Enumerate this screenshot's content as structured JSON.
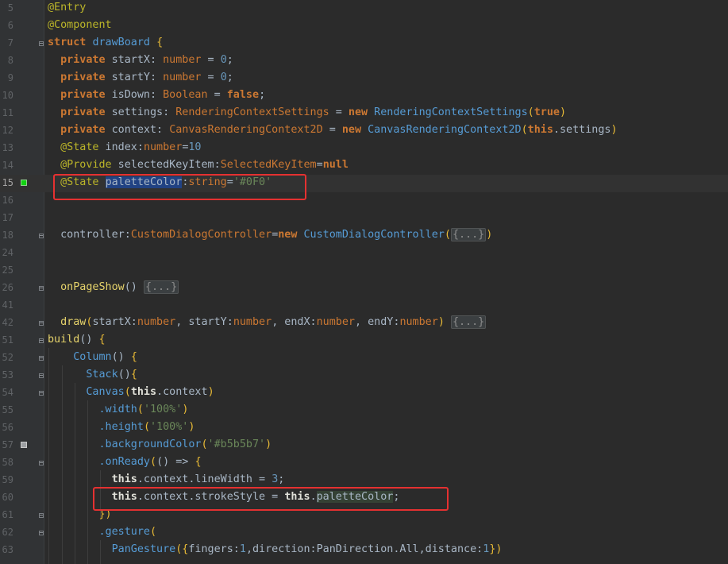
{
  "editor": {
    "lines": [
      {
        "num": "5",
        "tokens": [
          {
            "t": "@Entry",
            "c": "ann"
          }
        ]
      },
      {
        "num": "6",
        "tokens": [
          {
            "t": "@Component",
            "c": "ann"
          }
        ]
      },
      {
        "num": "7",
        "fold": true,
        "tokens": [
          {
            "t": "struct",
            "c": "kw"
          },
          {
            "t": " ",
            "c": "pu"
          },
          {
            "t": "drawBoard",
            "c": "cls"
          },
          {
            "t": " ",
            "c": "pu"
          },
          {
            "t": "{",
            "c": "br"
          }
        ]
      },
      {
        "num": "8",
        "tokens": [
          {
            "t": "  private",
            "c": "kw"
          },
          {
            "t": " startX: ",
            "c": "id"
          },
          {
            "t": "number",
            "c": "ty"
          },
          {
            "t": " = ",
            "c": "pu"
          },
          {
            "t": "0",
            "c": "num"
          },
          {
            "t": ";",
            "c": "pu"
          }
        ]
      },
      {
        "num": "9",
        "tokens": [
          {
            "t": "  private",
            "c": "kw"
          },
          {
            "t": " startY: ",
            "c": "id"
          },
          {
            "t": "number",
            "c": "ty"
          },
          {
            "t": " = ",
            "c": "pu"
          },
          {
            "t": "0",
            "c": "num"
          },
          {
            "t": ";",
            "c": "pu"
          }
        ]
      },
      {
        "num": "10",
        "tokens": [
          {
            "t": "  private",
            "c": "kw"
          },
          {
            "t": " isDown: ",
            "c": "id"
          },
          {
            "t": "Boolean",
            "c": "ty"
          },
          {
            "t": " = ",
            "c": "pu"
          },
          {
            "t": "false",
            "c": "kw"
          },
          {
            "t": ";",
            "c": "pu"
          }
        ]
      },
      {
        "num": "11",
        "tokens": [
          {
            "t": "  private",
            "c": "kw"
          },
          {
            "t": " settings: ",
            "c": "id"
          },
          {
            "t": "RenderingContextSettings",
            "c": "ty"
          },
          {
            "t": " = ",
            "c": "pu"
          },
          {
            "t": "new",
            "c": "kw"
          },
          {
            "t": " ",
            "c": "pu"
          },
          {
            "t": "RenderingContextSettings",
            "c": "cls"
          },
          {
            "t": "(",
            "c": "br"
          },
          {
            "t": "true",
            "c": "kw"
          },
          {
            "t": ")",
            "c": "br"
          }
        ]
      },
      {
        "num": "12",
        "tokens": [
          {
            "t": "  private",
            "c": "kw"
          },
          {
            "t": " context: ",
            "c": "id"
          },
          {
            "t": "CanvasRenderingContext2D",
            "c": "ty"
          },
          {
            "t": " = ",
            "c": "pu"
          },
          {
            "t": "new",
            "c": "kw"
          },
          {
            "t": " ",
            "c": "pu"
          },
          {
            "t": "CanvasRenderingContext2D",
            "c": "cls"
          },
          {
            "t": "(",
            "c": "br"
          },
          {
            "t": "this",
            "c": "kw"
          },
          {
            "t": ".settings",
            "c": "id"
          },
          {
            "t": ")",
            "c": "br"
          }
        ]
      },
      {
        "num": "13",
        "tokens": [
          {
            "t": "  @State",
            "c": "ann"
          },
          {
            "t": " index:",
            "c": "id"
          },
          {
            "t": "number",
            "c": "ty"
          },
          {
            "t": "=",
            "c": "pu"
          },
          {
            "t": "10",
            "c": "num"
          }
        ]
      },
      {
        "num": "14",
        "tokens": [
          {
            "t": "  @Provide",
            "c": "ann"
          },
          {
            "t": " selectedKeyItem:",
            "c": "id"
          },
          {
            "t": "SelectedKeyItem",
            "c": "ty"
          },
          {
            "t": "=",
            "c": "pu"
          },
          {
            "t": "null",
            "c": "kw"
          }
        ]
      },
      {
        "num": "15",
        "current": true,
        "marker": "green",
        "tokens": [
          {
            "t": "  ",
            "c": "pu"
          },
          {
            "t": "@State",
            "c": "ann"
          },
          {
            "t": " ",
            "c": "pu"
          },
          {
            "t": "paletteColor",
            "c": "sel"
          },
          {
            "t": ":",
            "c": "pu"
          },
          {
            "t": "string",
            "c": "ty"
          },
          {
            "t": "=",
            "c": "pu"
          },
          {
            "t": "'#0F0'",
            "c": "str"
          }
        ]
      },
      {
        "num": "16",
        "tokens": []
      },
      {
        "num": "17",
        "tokens": []
      },
      {
        "num": "18",
        "fold": true,
        "tokens": [
          {
            "t": "  controller:",
            "c": "id"
          },
          {
            "t": "CustomDialogController",
            "c": "ty"
          },
          {
            "t": "=",
            "c": "pu"
          },
          {
            "t": "new",
            "c": "kw"
          },
          {
            "t": " ",
            "c": "pu"
          },
          {
            "t": "CustomDialogController",
            "c": "cls"
          },
          {
            "t": "(",
            "c": "br"
          },
          {
            "t": "{...}",
            "c": "fd"
          },
          {
            "t": ")",
            "c": "br"
          }
        ]
      },
      {
        "num": "24",
        "tokens": []
      },
      {
        "num": "25",
        "tokens": []
      },
      {
        "num": "26",
        "fold": true,
        "tokens": [
          {
            "t": "  onPageShow",
            "c": "ye"
          },
          {
            "t": "() ",
            "c": "pu"
          },
          {
            "t": "{...}",
            "c": "fd"
          }
        ]
      },
      {
        "num": "41",
        "tokens": []
      },
      {
        "num": "42",
        "fold": true,
        "tokens": [
          {
            "t": "  draw",
            "c": "ye"
          },
          {
            "t": "(",
            "c": "br"
          },
          {
            "t": "startX:",
            "c": "id"
          },
          {
            "t": "number",
            "c": "ty"
          },
          {
            "t": ", startY:",
            "c": "id"
          },
          {
            "t": "number",
            "c": "ty"
          },
          {
            "t": ", endX:",
            "c": "id"
          },
          {
            "t": "number",
            "c": "ty"
          },
          {
            "t": ", endY:",
            "c": "id"
          },
          {
            "t": "number",
            "c": "ty"
          },
          {
            "t": ")",
            "c": "br"
          },
          {
            "t": " ",
            "c": "pu"
          },
          {
            "t": "{...}",
            "c": "fd"
          }
        ]
      },
      {
        "num": "51",
        "fold": true,
        "tokens": [
          {
            "t": "build",
            "c": "ye"
          },
          {
            "t": "() ",
            "c": "pu"
          },
          {
            "t": "{",
            "c": "br"
          }
        ]
      },
      {
        "num": "52",
        "fold": true,
        "tokens": [
          {
            "t": "    Column",
            "c": "cls"
          },
          {
            "t": "() ",
            "c": "pu"
          },
          {
            "t": "{",
            "c": "br"
          }
        ]
      },
      {
        "num": "53",
        "fold": true,
        "tokens": [
          {
            "t": "      Stack",
            "c": "cls"
          },
          {
            "t": "()",
            "c": "pu"
          },
          {
            "t": "{",
            "c": "br"
          }
        ]
      },
      {
        "num": "54",
        "fold": true,
        "tokens": [
          {
            "t": "      Canvas",
            "c": "cls"
          },
          {
            "t": "(",
            "c": "br"
          },
          {
            "t": "this",
            "c": "bld"
          },
          {
            "t": ".context",
            "c": "id"
          },
          {
            "t": ")",
            "c": "br"
          }
        ]
      },
      {
        "num": "55",
        "tokens": [
          {
            "t": "        .width",
            "c": "cls"
          },
          {
            "t": "(",
            "c": "br"
          },
          {
            "t": "'100%'",
            "c": "str"
          },
          {
            "t": ")",
            "c": "br"
          }
        ]
      },
      {
        "num": "56",
        "tokens": [
          {
            "t": "        .height",
            "c": "cls"
          },
          {
            "t": "(",
            "c": "br"
          },
          {
            "t": "'100%'",
            "c": "str"
          },
          {
            "t": ")",
            "c": "br"
          }
        ]
      },
      {
        "num": "57",
        "marker": "gray",
        "tokens": [
          {
            "t": "        .backgroundColor",
            "c": "cls"
          },
          {
            "t": "(",
            "c": "br"
          },
          {
            "t": "'#b5b5b7'",
            "c": "str"
          },
          {
            "t": ")",
            "c": "br"
          }
        ]
      },
      {
        "num": "58",
        "fold": true,
        "tokens": [
          {
            "t": "        .onReady",
            "c": "cls"
          },
          {
            "t": "(",
            "c": "br"
          },
          {
            "t": "() => ",
            "c": "pu"
          },
          {
            "t": "{",
            "c": "br"
          }
        ]
      },
      {
        "num": "59",
        "tokens": [
          {
            "t": "          this",
            "c": "bld"
          },
          {
            "t": ".context.lineWidth = ",
            "c": "id"
          },
          {
            "t": "3",
            "c": "num"
          },
          {
            "t": ";",
            "c": "pu"
          }
        ]
      },
      {
        "num": "60",
        "tokens": [
          {
            "t": "          this",
            "c": "bld"
          },
          {
            "t": ".context.strokeStyle = ",
            "c": "id"
          },
          {
            "t": "this",
            "c": "bld"
          },
          {
            "t": ".",
            "c": "pu"
          },
          {
            "t": "paletteColor",
            "c": "hl"
          },
          {
            "t": ";",
            "c": "pu"
          }
        ]
      },
      {
        "num": "61",
        "fold": true,
        "tokens": [
          {
            "t": "        })",
            "c": "br"
          }
        ]
      },
      {
        "num": "62",
        "fold": true,
        "tokens": [
          {
            "t": "        .gesture",
            "c": "cls"
          },
          {
            "t": "(",
            "c": "br"
          }
        ]
      },
      {
        "num": "63",
        "tokens": [
          {
            "t": "          PanGesture",
            "c": "cls"
          },
          {
            "t": "({",
            "c": "br"
          },
          {
            "t": "fingers:",
            "c": "id"
          },
          {
            "t": "1",
            "c": "num"
          },
          {
            "t": ",direction:",
            "c": "id"
          },
          {
            "t": "PanDirection",
            "c": "id"
          },
          {
            "t": ".All,distance:",
            "c": "id"
          },
          {
            "t": "1",
            "c": "num"
          },
          {
            "t": "})",
            "c": "br"
          }
        ]
      }
    ]
  }
}
